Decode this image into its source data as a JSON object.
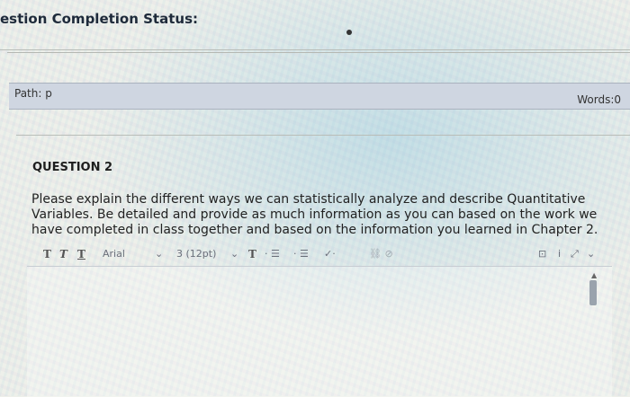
{
  "section_heading": "estion Completion Status:",
  "path_bar": {
    "path_label": "Path: p",
    "words_label": "Words:0"
  },
  "question": {
    "title": "QUESTION 2",
    "text": "Please explain the different ways we can statistically analyze and describe Quantitative Variables. Be detailed and provide as much information as you can based on the work we have completed in class together and based on the information you learned in Chapter 2."
  },
  "toolbar": {
    "font_name": "Arial",
    "font_size": "3 (12pt)"
  }
}
